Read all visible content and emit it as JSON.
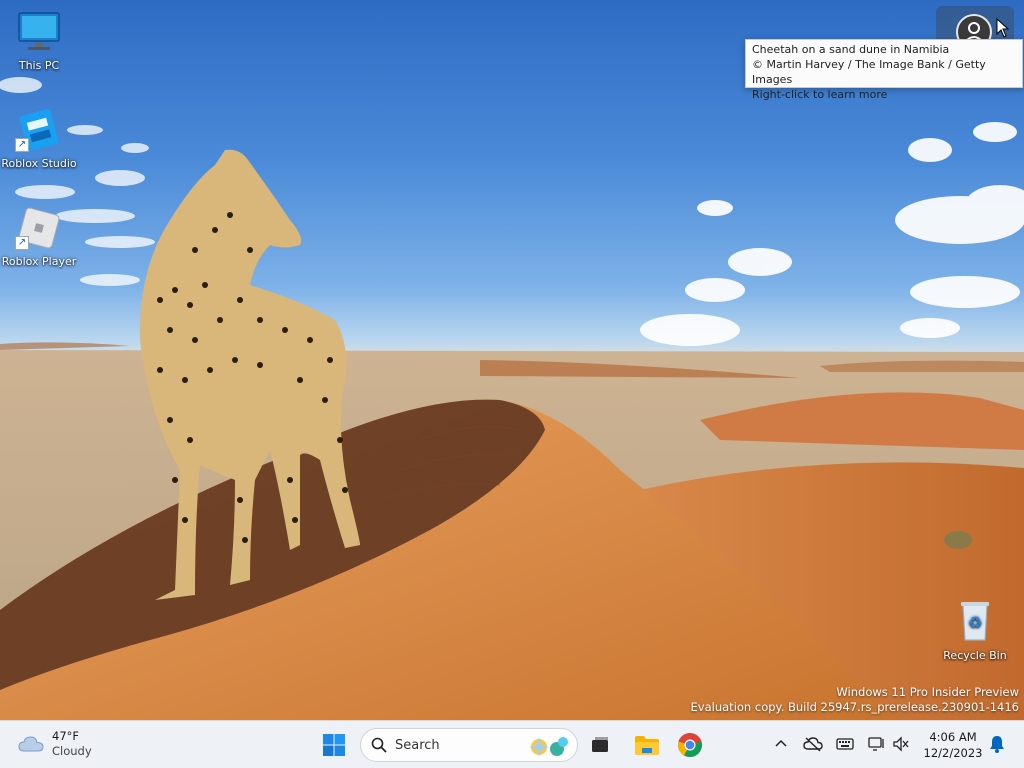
{
  "desktop": {
    "icons": [
      {
        "label": "This PC"
      },
      {
        "label": "Roblox Studio"
      },
      {
        "label": "Roblox Player"
      },
      {
        "label": "Recycle Bin"
      }
    ]
  },
  "spotlight": {
    "tooltip_lines": [
      "Cheetah on a sand dune in Namibia",
      "© Martin Harvey / The Image Bank / Getty Images",
      "Right-click to learn more"
    ]
  },
  "watermark": {
    "line1": "Windows 11 Pro Insider Preview",
    "line2": "Evaluation copy. Build 25947.rs_prerelease.230901-1416"
  },
  "taskbar": {
    "weather": {
      "temp": "47°F",
      "condition": "Cloudy",
      "icon": "cloud-icon"
    },
    "search": {
      "placeholder": "Search"
    },
    "pinned": [
      {
        "name": "start",
        "icon": "windows-logo-icon"
      },
      {
        "name": "task-view",
        "icon": "task-view-icon"
      },
      {
        "name": "file-explorer",
        "icon": "folder-icon"
      },
      {
        "name": "chrome",
        "icon": "chrome-icon"
      }
    ],
    "clock": {
      "time": "4:06 AM",
      "date": "12/2/2023"
    },
    "accent": "#0067c0"
  }
}
